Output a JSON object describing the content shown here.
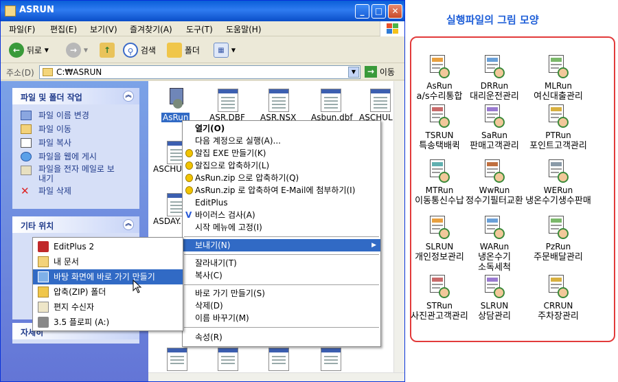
{
  "window": {
    "title": "ASRUN",
    "controls": {
      "minimize": "_",
      "maximize": "□",
      "close": "✕"
    }
  },
  "menubar": [
    "파일(F)",
    "편집(E)",
    "보기(V)",
    "즐겨찾기(A)",
    "도구(T)",
    "도움말(H)"
  ],
  "toolbar": {
    "back": "뒤로",
    "search": "검색",
    "folders": "폴더"
  },
  "address": {
    "label": "주소(D)",
    "value": "C:₩ASRUN",
    "go": "이동"
  },
  "taskpane": {
    "file_tasks": {
      "title": "파일 및 폴더 작업",
      "items": [
        "파일 이름 변경",
        "파일 이동",
        "파일 복사",
        "파일을 웹에 게시",
        "파일을 전자 메일로 보",
        "내기",
        "파일 삭제"
      ]
    },
    "other_places": {
      "title": "기타 위치"
    },
    "details": {
      "title": "자세히"
    }
  },
  "files": {
    "row1": [
      "AsRun",
      "ASR.DBF",
      "ASR.NSX",
      "Asbun.dbf",
      "ASCHUL"
    ],
    "row2": [
      "ASCHU"
    ],
    "row3": [
      "ASDAY."
    ]
  },
  "context_menu": {
    "items": [
      "열기(O)",
      "다음 계정으로 실행(A)...",
      "알집 EXE 만들기(K)",
      "알집으로 압축하기(L)",
      "AsRun.zip 으로 압축하기(Q)",
      "AsRun.zip 로 압축하여 E-Mail에 첨부하기(I)",
      "EditPlus",
      "바이러스 검사(A)",
      "시작 메뉴에 고정(I)",
      "보내기(N)",
      "잘라내기(T)",
      "복사(C)",
      "바로 가기 만들기(S)",
      "삭제(D)",
      "이름 바꾸기(M)",
      "속성(R)"
    ]
  },
  "send_to_menu": {
    "items": [
      "EditPlus 2",
      "내 문서",
      "바탕 화면에 바로 가기 만들기",
      "압축(ZIP) 폴더",
      "편지 수신자",
      "3.5 플로피 (A:)"
    ]
  },
  "right_panel": {
    "title": "실행파일의 그림 모양",
    "apps": [
      {
        "name": "AsRun",
        "desc": "a/s수리통합"
      },
      {
        "name": "DRRun",
        "desc": "대리운전관리"
      },
      {
        "name": "MLRun",
        "desc": "여신대출관리"
      },
      {
        "name": "TSRUN",
        "desc": "특송택배퀵"
      },
      {
        "name": "SaRun",
        "desc": "판매고객관리"
      },
      {
        "name": "PTRun",
        "desc": "포인트고객관리"
      },
      {
        "name": "MTRun",
        "desc": "이동통신수납"
      },
      {
        "name": "WwRun",
        "desc": "정수기필터교환"
      },
      {
        "name": "WERun",
        "desc": "냉온수기생수판매"
      },
      {
        "name": "SLRUN",
        "desc": "개인정보관리"
      },
      {
        "name": "WARun",
        "desc": "냉온수기",
        "desc2": "소독세척"
      },
      {
        "name": "PzRun",
        "desc": "주문배달관리"
      },
      {
        "name": "STRun",
        "desc": "사진관고객관리"
      },
      {
        "name": "SLRUN",
        "desc": "상담관리"
      },
      {
        "name": "CRRUN",
        "desc": "주차장관리"
      }
    ]
  }
}
